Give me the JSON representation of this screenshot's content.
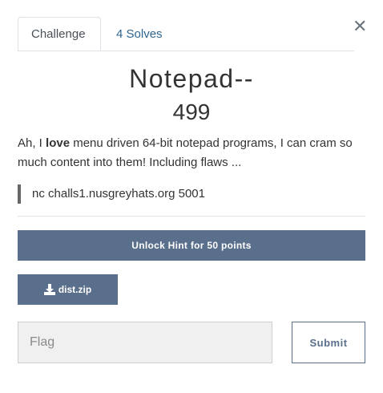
{
  "tabs": {
    "challenge_label": "Challenge",
    "solves_label": "4 Solves"
  },
  "close_icon": "close-icon",
  "challenge": {
    "name": "Notepad--",
    "value": "499",
    "description_prefix": "Ah, I ",
    "description_bold": "love",
    "description_suffix": " menu driven 64-bit notepad programs, I can cram so much content into them! Including flaws ...",
    "connection": "nc challs1.nusgreyhats.org 5001"
  },
  "hint": {
    "label": "Unlock Hint for 50 points"
  },
  "file": {
    "icon": "download-icon",
    "label": "dist.zip"
  },
  "flag": {
    "placeholder": "Flag",
    "value": ""
  },
  "submit": {
    "label": "Submit"
  },
  "colors": {
    "primary": "#5a6f8c",
    "link": "#2f6690",
    "input_bg": "#f0f0f0"
  }
}
